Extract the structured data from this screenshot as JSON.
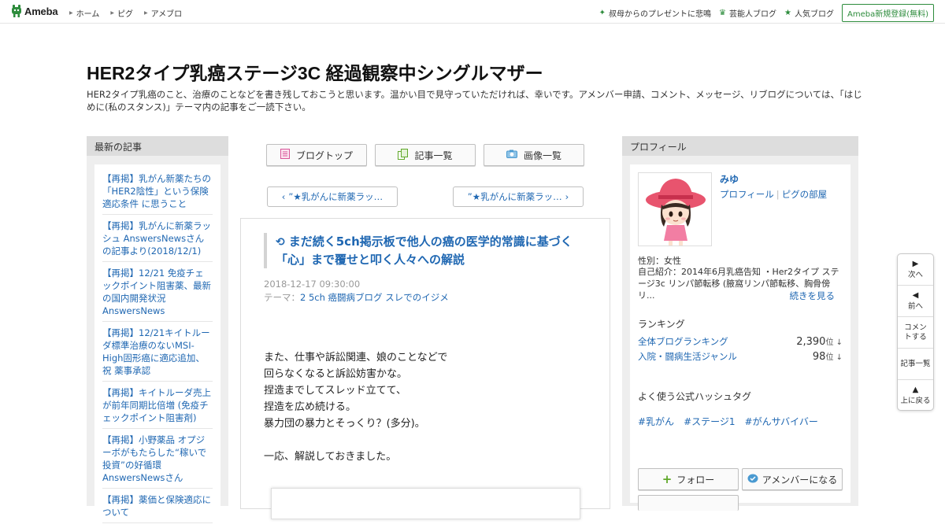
{
  "topbar": {
    "logo_text": "Ameba",
    "nav": [
      {
        "label": "ホーム"
      },
      {
        "label": "ピグ"
      },
      {
        "label": "アメブロ"
      }
    ],
    "right_links": [
      {
        "label": "叔母からのプレゼントに悲鳴",
        "icon": "star-icon"
      },
      {
        "label": "芸能人ブログ",
        "icon": "crown-icon"
      },
      {
        "label": "人気ブログ",
        "icon": "star-icon"
      }
    ],
    "register_label": "Ameba新規登録(無料)"
  },
  "header": {
    "title": "HER2タイプ乳癌ステージ3C 経過観察中シングルマザー",
    "description": "HER2タイプ乳癌のこと、治療のことなどを書き残しておこうと思います。温かい目で見守っていただければ、幸いです。アメンバー申請、コメント、メッセージ、リブログについては、「はじめに(私のスタンス)」テーマ内の記事をご一読下さい。"
  },
  "left_sidebar": {
    "heading": "最新の記事",
    "items": [
      {
        "label": "【再掲】乳がん新薬たちの「HER2陰性」という保険適応条件 に思うこと"
      },
      {
        "label": "【再掲】乳がんに新薬ラッシュ AnswersNewsさんの記事より(2018/12/1)"
      },
      {
        "label": "【再掲】12/21 免疫チェックポイント阻害薬、最新の国内開発状況 AnswersNews"
      },
      {
        "label": "【再掲】12/21キイトルーダ標準治療のないMSI-High固形癌に適応追加、祝 薬事承認"
      },
      {
        "label": "【再掲】キイトルーダ売上が前年同期比倍増 (免疫チェックポイント阻害剤)"
      },
      {
        "label": "【再掲】小野薬品 オプジーボがもたらした“稼いで投資”の好循環 AnswersNewsさん"
      },
      {
        "label": "【再掲】薬価と保険適応について"
      }
    ]
  },
  "center": {
    "buttons": [
      {
        "label": "ブログトップ",
        "icon": "blog-top-icon"
      },
      {
        "label": "記事一覧",
        "icon": "article-list-icon"
      },
      {
        "label": "画像一覧",
        "icon": "camera-icon"
      }
    ],
    "prev_label": "”★乳がんに新薬ラッ…",
    "next_label": "”★乳がんに新薬ラッ…",
    "article": {
      "title": "まだ続く5ch掲示板で他人の癌の医学的常識に基づく「心」まで覆せと叩く人々への解説",
      "date": "2018-12-17 09:30:00",
      "theme_prefix": "テーマ：",
      "theme": "2 5ch 癌闘病ブログ スレでのイジメ",
      "body": "また、仕事や訴訟関連、娘のことなどで\n回らなくなると訴訟妨害かな。\n捏造までしてスレッド立てて、\n捏造を広め続ける。\n暴力団の暴力とそっくり？(多分)。\n\n一応、解説しておきました。"
    }
  },
  "right_sidebar": {
    "heading": "プロフィール",
    "name": "みゆ",
    "profile_link": "プロフィール",
    "pigg_link": "ピグの部屋",
    "gender": "性別：女性",
    "intro": "自己紹介：2014年6月乳癌告知 ・Her2タイプ ステージ3c リンパ節転移 (腋窩リンパ節転移、胸骨傍リ...",
    "read_more": "続きを見る",
    "ranking_heading": "ランキング",
    "rankings": [
      {
        "label": "全体ブログランキング",
        "value": "2,390",
        "unit": "位 ↓"
      },
      {
        "label": "入院・闘病生活ジャンル",
        "value": "98",
        "unit": "位 ↓"
      }
    ],
    "hashtag_heading": "よく使う公式ハッシュタグ",
    "hashtags": [
      "#乳がん",
      "#ステージ1",
      "#がんサバイバー"
    ],
    "follow_label": "フォロー",
    "amember_label": "アメンバーになる"
  },
  "float_nav": [
    {
      "label": "次へ",
      "icon": "play-right-icon"
    },
    {
      "label": "前へ",
      "icon": "play-left-icon"
    },
    {
      "label": "コメントする",
      "icon": ""
    },
    {
      "label": "記事一覧",
      "icon": ""
    },
    {
      "label": "上に戻る",
      "icon": "triangle-up-icon"
    }
  ],
  "colors": {
    "link": "#1f67b2",
    "brand_green": "#2d8c3c",
    "sidebar_bg": "#eeeeee",
    "sidebar_head": "#dddddd"
  }
}
